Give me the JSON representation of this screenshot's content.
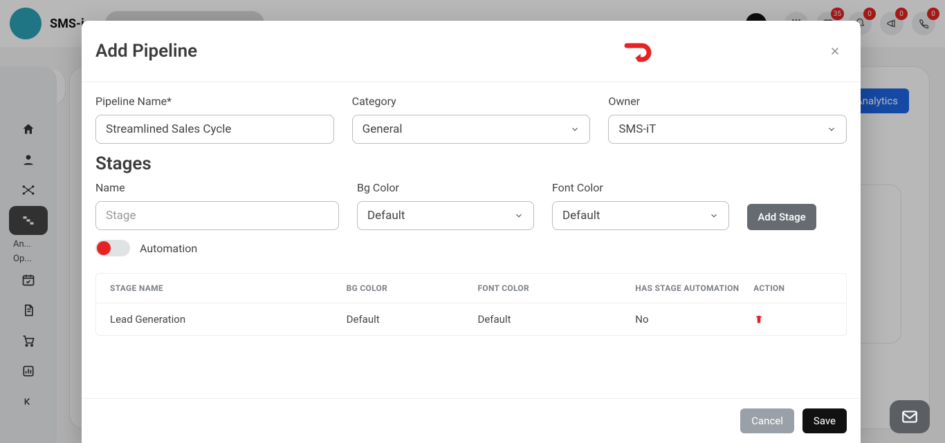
{
  "header": {
    "app_name": "SMS-i",
    "badges": {
      "calendar": "35",
      "megaphone": "0",
      "bell": "0",
      "phone": "0"
    }
  },
  "sidebar_logo": "SMS-iT",
  "analytics_label": "Analytics",
  "sidebar_sub": {
    "an": "An...",
    "op": "Op..."
  },
  "modal": {
    "title": "Add Pipeline",
    "labels": {
      "pipeline_name": "Pipeline Name*",
      "category": "Category",
      "owner": "Owner",
      "stages_heading": "Stages",
      "stage_name": "Name",
      "bg_color": "Bg Color",
      "font_color": "Font Color",
      "automation": "Automation"
    },
    "values": {
      "pipeline_name": "Streamlined Sales Cycle",
      "category": "General",
      "owner": "SMS-iT",
      "stage_placeholder": "Stage",
      "bg_color": "Default",
      "font_color": "Default"
    },
    "buttons": {
      "add_stage": "Add Stage",
      "cancel": "Cancel",
      "save": "Save"
    },
    "table": {
      "headers": {
        "stage_name": "STAGE NAME",
        "bg_color": "BG COLOR",
        "font_color": "FONT COLOR",
        "has_automation": "HAS STAGE AUTOMATION",
        "action": "ACTION"
      },
      "rows": [
        {
          "stage_name": "Lead Generation",
          "bg_color": "Default",
          "font_color": "Default",
          "has_automation": "No"
        }
      ]
    }
  }
}
